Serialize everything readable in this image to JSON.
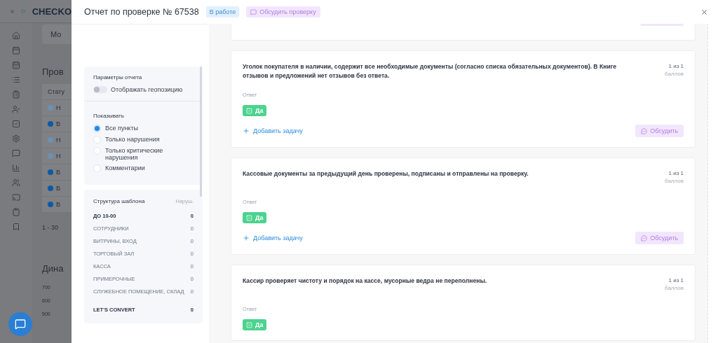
{
  "background_app": {
    "logo": "CHECKO",
    "tab_label": "Мо",
    "table_title": "Пров",
    "status_header": "Стату",
    "rows": [
      {
        "status": "Н",
        "color": "#6a92b5"
      },
      {
        "status": "В",
        "color": "#0c5aa8"
      },
      {
        "status": "Н",
        "color": "#6a92b5"
      },
      {
        "status": "Н",
        "color": "#6a92b5"
      },
      {
        "status": "В",
        "color": "#0c5aa8"
      },
      {
        "status": "В",
        "color": "#0c5aa8"
      },
      {
        "status": "В",
        "color": "#0c5aa8"
      }
    ],
    "pagination": "1 - 30",
    "chart_title": "Дина",
    "chart_ticks": [
      "700",
      "600",
      "500"
    ]
  },
  "report": {
    "title": "Отчет по проверке № 67538",
    "status": "В работе",
    "discuss_button": "Обсудить проверку",
    "settings": {
      "title": "Параметры отчета",
      "toggle": {
        "label": "Отображать геопозицию",
        "on": false
      }
    },
    "filter": {
      "title": "Показывать",
      "options": [
        {
          "label": "Все пункты",
          "selected": true
        },
        {
          "label": "Только нарушения",
          "selected": false
        },
        {
          "label": "Только критические нарушения",
          "selected": false
        },
        {
          "label": "Комментарии",
          "selected": false
        }
      ]
    },
    "structure": {
      "title": "Структура шаблона",
      "column": "Наруш.",
      "sections": [
        {
          "name": "ДО 10-00",
          "count": "0",
          "kind": "group"
        },
        {
          "name": "СОТРУДНИКИ",
          "count": "0",
          "kind": "item"
        },
        {
          "name": "ВИТРИНЫ, ВХОД",
          "count": "0",
          "kind": "item"
        },
        {
          "name": "ТОРГОВЫЙ ЗАЛ",
          "count": "0",
          "kind": "item"
        },
        {
          "name": "КАССА",
          "count": "0",
          "kind": "item"
        },
        {
          "name": "ПРИМЕРОЧНЫЕ",
          "count": "0",
          "kind": "item"
        },
        {
          "name": "СЛУЖЕБНОЕ ПОМЕЩЕНИЕ, СКЛАД",
          "count": "0",
          "kind": "item"
        },
        {
          "name": "LET'S CONVERT",
          "count": "0",
          "kind": "group"
        }
      ]
    },
    "questions": [
      {
        "text": "Уголок покупателя в наличии, содержит все необходимые документы (согласно списка обязательных документов). В Книге отзывов и предложений нет отзывов без ответа.",
        "score": "1 из 1",
        "unit": "баллов",
        "answer_label": "Ответ",
        "answer": "Да",
        "add_task": "Добавить задачу",
        "discuss": "Обсудить"
      },
      {
        "text": "Кассовые документы за предыдущий день проверены, подписаны и отправлены на проверку.",
        "score": "1 из 1",
        "unit": "баллов",
        "answer_label": "Ответ",
        "answer": "Да",
        "add_task": "Добавить задачу",
        "discuss": "Обсудить"
      },
      {
        "text": "Кассир проверяет чистоту и порядок на кассе, мусорные ведра не переполнены.",
        "score": "1 из 1",
        "unit": "баллов",
        "answer_label": "Ответ",
        "answer": "Да"
      }
    ]
  }
}
